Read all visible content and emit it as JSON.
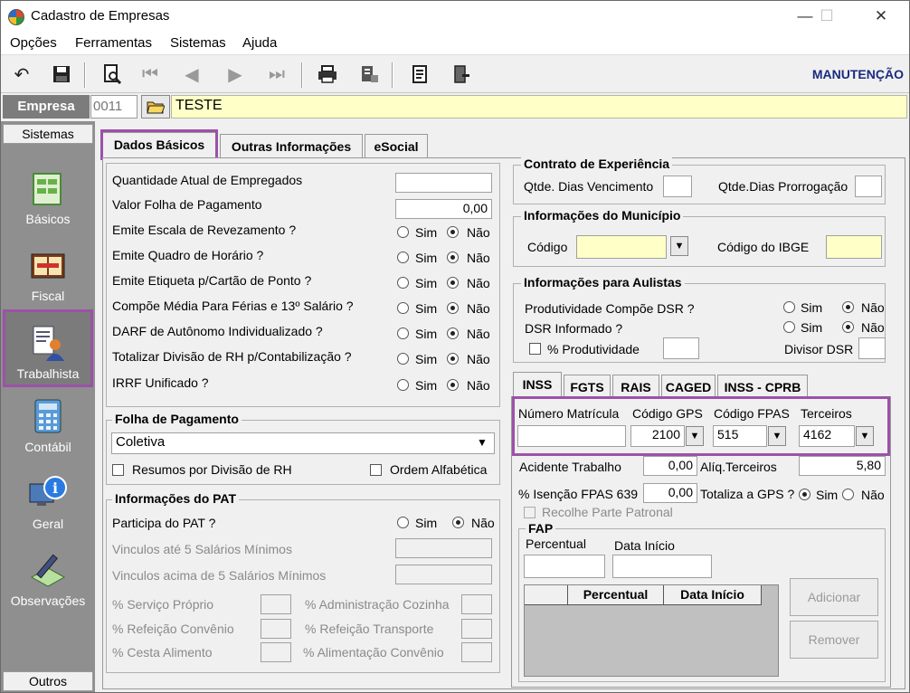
{
  "window": {
    "title": "Cadastro de Empresas",
    "minimize": "—",
    "maximize": "☐",
    "close": "✕"
  },
  "menu": [
    "Opções",
    "Ferramentas",
    "Sistemas",
    "Ajuda"
  ],
  "toolbar": {
    "mode": "MANUTENÇÃO"
  },
  "empresa": {
    "label": "Empresa",
    "code": "0011",
    "name": "TESTE"
  },
  "sidebar": {
    "header": "Sistemas",
    "footer": "Outros",
    "items": [
      "Básicos",
      "Fiscal",
      "Trabalhista",
      "Contábil",
      "Geral",
      "Observações"
    ]
  },
  "tabs": [
    "Dados Básicos",
    "Outras Informações",
    "eSocial"
  ],
  "left": {
    "quantidade": "Quantidade Atual de Empregados",
    "valor_folha": "Valor Folha de Pagamento",
    "valor_folha_value": "0,00",
    "questions": [
      "Emite Escala de Revezamento ?",
      "Emite Quadro de Horário ?",
      "Emite Etiqueta p/Cartão de Ponto ?",
      "Compõe Média Para Férias e 13º Salário ?",
      "DARF de Autônomo Individualizado ?",
      "Totalizar Divisão de RH p/Contabilização ?",
      "IRRF Unificado ?"
    ],
    "sim": "Sim",
    "nao": "Não"
  },
  "folha": {
    "title": "Folha de Pagamento",
    "select_value": "Coletiva",
    "resumos": "Resumos por Divisão de RH",
    "ordem": "Ordem Alfabética"
  },
  "pat": {
    "title": "Informações do PAT",
    "participa": "Participa do PAT ?",
    "vinc5": "Vinculos até 5 Salários Mínimos",
    "vinc5acima": "Vinculos acima de 5 Salários Mínimos",
    "servico": "% Serviço Próprio",
    "refeicao": "% Refeição Convênio",
    "cesta": "% Cesta Alimento",
    "adm": "% Administração Cozinha",
    "ref_transp": "% Refeição Transporte",
    "alim": "% Alimentação Convênio"
  },
  "contrato": {
    "title": "Contrato de Experiência",
    "venc": "Qtde. Dias Vencimento",
    "prorr": "Qtde.Dias Prorrogação"
  },
  "municipio": {
    "title": "Informações do Município",
    "codigo": "Código",
    "ibge": "Código do IBGE"
  },
  "aulistas": {
    "title": "Informações para Aulistas",
    "prod_dsr": "Produtividade Compõe DSR ?",
    "dsr_inf": "DSR Informado ?",
    "perc_prod": "% Produtividade",
    "divisor": "Divisor DSR"
  },
  "subtabs": [
    "INSS",
    "FGTS",
    "RAIS",
    "CAGED",
    "INSS - CPRB"
  ],
  "inss": {
    "num_matricula": "Número Matrícula",
    "cod_gps": "Código GPS",
    "cod_gps_value": "2100",
    "cod_fpas": "Código FPAS",
    "cod_fpas_value": "515",
    "terceiros": "Terceiros",
    "terceiros_value": "4162",
    "acidente": "Acidente Trabalho",
    "acidente_value": "0,00",
    "aliq": "Alíq.Terceiros",
    "aliq_value": "5,80",
    "isencao": "% Isenção FPAS 639",
    "isencao_value": "0,00",
    "totaliza": "Totaliza a GPS ?",
    "recolhe": "Recolhe Parte Patronal"
  },
  "fap": {
    "title": "FAP",
    "percentual": "Percentual",
    "data_inicio": "Data Início",
    "col_percentual": "Percentual",
    "col_data": "Data Início",
    "adicionar": "Adicionar",
    "remover": "Remover"
  }
}
